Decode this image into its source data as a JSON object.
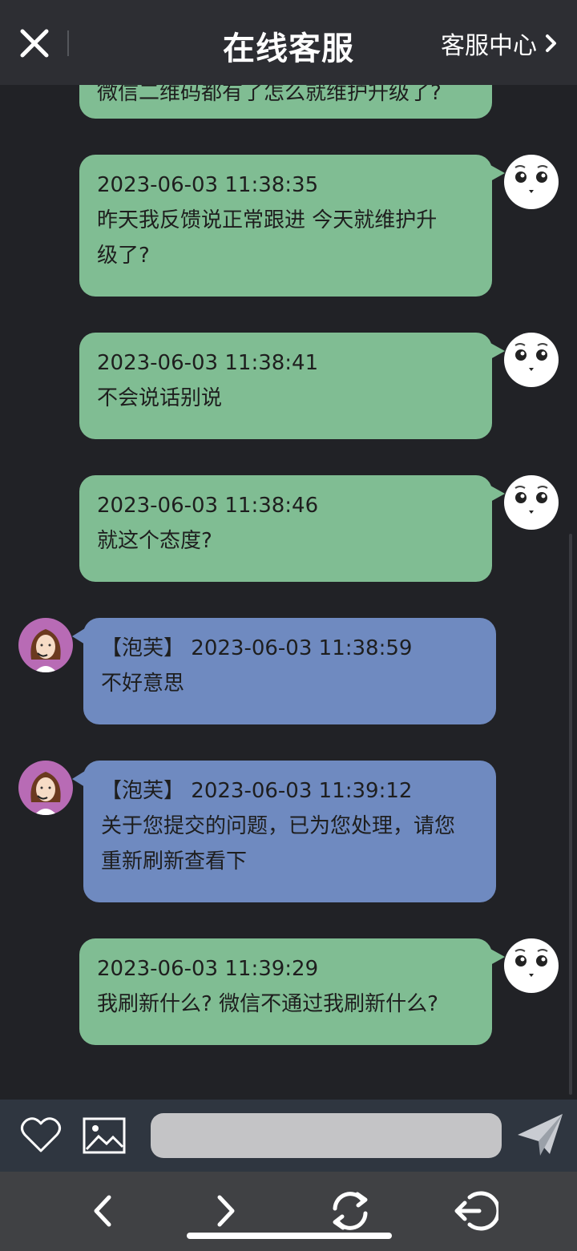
{
  "header": {
    "title": "在线客服",
    "service_center_label": "客服中心"
  },
  "messages": [
    {
      "sender": "user",
      "time": "",
      "text": "微信二维码都有了怎么就维护升级了?"
    },
    {
      "sender": "user",
      "time": "2023-06-03 11:38:35",
      "text_line1": "昨天我反馈说正常跟进 今天就维护升",
      "text_line2": "级了?"
    },
    {
      "sender": "user",
      "time": "2023-06-03 11:38:41",
      "text": "不会说话别说"
    },
    {
      "sender": "user",
      "time": "2023-06-03 11:38:46",
      "text": "就这个态度?"
    },
    {
      "sender": "agent",
      "agent_name": "【泡芙】",
      "time": "2023-06-03 11:38:59",
      "text": "不好意思"
    },
    {
      "sender": "agent",
      "agent_name": "【泡芙】",
      "time": "2023-06-03 11:39:12",
      "text_line1": "关于您提交的问题，已为您处理，请您",
      "text_line2": "重新刷新查看下"
    },
    {
      "sender": "user",
      "time": "2023-06-03 11:39:29",
      "text": "我刷新什么? 微信不通过我刷新什么?"
    }
  ],
  "composer": {
    "placeholder": ""
  },
  "icons": {
    "close": "close-icon",
    "chevron": "chevron-right-icon",
    "favorite": "heart-icon",
    "image": "image-icon",
    "send": "send-icon",
    "back": "back-icon",
    "forward": "forward-icon",
    "refresh": "refresh-icon",
    "exit": "exit-icon"
  },
  "colors": {
    "background": "#212226",
    "header": "#2d2e33",
    "user_bubble": "#80bd93",
    "agent_bubble": "#6f8ac0",
    "input_bar": "#2f3640",
    "nav_bar": "#404144"
  }
}
